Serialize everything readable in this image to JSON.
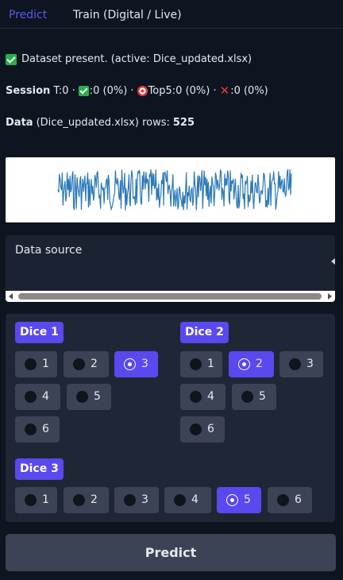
{
  "tabs": [
    {
      "label": "Predict",
      "active": true
    },
    {
      "label": "Train (Digital / Live)",
      "active": false
    }
  ],
  "status": {
    "dataset_text": "Dataset present. (active: Dice_updated.xlsx)"
  },
  "session": {
    "label": "Session",
    "total": "T:0 ·",
    "correct": ":0 (0%) ·",
    "top5": "Top5:0 (0%) ·",
    "wrong": ":0 (0%)"
  },
  "data_info": {
    "label": "Data",
    "file": "(Dice_updated.xlsx) rows:",
    "rows": "525"
  },
  "chart": {
    "color": "#2b78b8",
    "description_values_count": 525
  },
  "data_source": {
    "label": "Data source"
  },
  "dice": [
    {
      "label": "Dice 1",
      "options": [
        "1",
        "2",
        "3",
        "4",
        "5",
        "6"
      ],
      "selected": "3"
    },
    {
      "label": "Dice 2",
      "options": [
        "1",
        "2",
        "3",
        "4",
        "5",
        "6"
      ],
      "selected": "2"
    },
    {
      "label": "Dice 3",
      "options": [
        "1",
        "2",
        "3",
        "4",
        "5",
        "6"
      ],
      "selected": "5"
    }
  ],
  "predict_button": {
    "label": "Predict"
  },
  "colors": {
    "accent": "#5a49ee",
    "tab_active": "#5b5bf0",
    "background": "#0e1420",
    "success": "#26b04b",
    "error": "#e23b3b"
  }
}
